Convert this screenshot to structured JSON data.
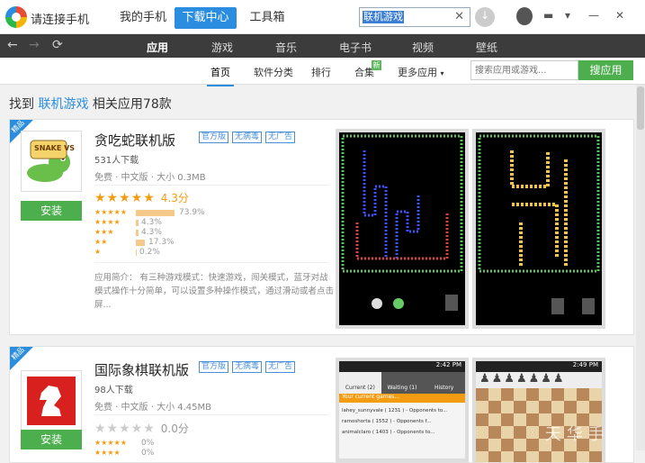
{
  "app": {
    "title": "请连接手机"
  },
  "topbar": {
    "tabs": [
      {
        "label": "我的手机",
        "active": false
      },
      {
        "label": "下载中心",
        "active": true
      },
      {
        "label": "工具箱",
        "active": false
      }
    ],
    "search_value": "联机游戏",
    "close_glyph": "✕"
  },
  "window": {
    "minimize": "—",
    "restore": "▾",
    "close": "✕",
    "menu": "▬"
  },
  "navbar": {
    "back": "←",
    "forward": "→",
    "refresh": "⟳",
    "categories": [
      "应用",
      "游戏",
      "音乐",
      "电子书",
      "视频",
      "壁纸"
    ],
    "active_category": "应用"
  },
  "subnav": {
    "items": [
      "首页",
      "软件分类",
      "排行",
      "合集",
      "更多应用"
    ],
    "active": "首页",
    "new_badge": "新",
    "more_arrow": "▾",
    "search_placeholder": "搜索应用或游戏...",
    "search_button": "搜应用"
  },
  "results": {
    "prefix": "找到",
    "keyword": "联机游戏",
    "suffix": "相关应用78款"
  },
  "cards": [
    {
      "ribbon": "精品",
      "name": "贪吃蛇联机版",
      "tags": [
        "官方版",
        "无病毒",
        "无广告"
      ],
      "downloads": "531人下载",
      "meta": "免费 · 中文版 · 大小 0.3MB",
      "install": "安装",
      "rating_stars": "★★★★★",
      "rating": "4.3分",
      "distribution": [
        {
          "stars": "★★★★★",
          "pct": "73.9%",
          "value": 73.9
        },
        {
          "stars": "★★★★",
          "pct": "4.3%",
          "value": 4.3
        },
        {
          "stars": "★★★",
          "pct": "4.3%",
          "value": 4.3
        },
        {
          "stars": "★★",
          "pct": "17.3%",
          "value": 17.3
        },
        {
          "stars": "★",
          "pct": "0.2%",
          "value": 0.2
        }
      ],
      "description": "应用简介： 有三种游戏模式：快速游戏，闯关模式，蓝牙对战模式操作十分简单，可以设置多种操作模式，通过滑动或者点击屏...",
      "icon_text": "SNAKE VS"
    },
    {
      "ribbon": "精品",
      "name": "国际象棋联机版",
      "tags": [
        "官方版",
        "无病毒",
        "无广告"
      ],
      "downloads": "98人下载",
      "meta": "免费 · 中文版 · 大小 4.45MB",
      "install": "安装",
      "rating_stars": "★★★★★",
      "rating": "0.0分",
      "distribution": [
        {
          "stars": "★★★★★",
          "pct": "0%",
          "value": 0
        },
        {
          "stars": "★★★★",
          "pct": "0%",
          "value": 0
        }
      ]
    }
  ],
  "screenshots": {
    "chess_time_1": "2:42 PM",
    "chess_time_2": "2:49 PM",
    "chess_tabs": [
      "Current (2)",
      "Waiting (1)",
      "History"
    ],
    "chess_header": "Your current games...",
    "chess_rows": [
      "lahey_sunnyvale ( 1231 ) - Opponents to...",
      "ramoshorta ( 1552 ) - Opponents f...",
      "animalclaro ( 1403 ) - Opponents to..."
    ]
  },
  "watermark": "天 华 手"
}
